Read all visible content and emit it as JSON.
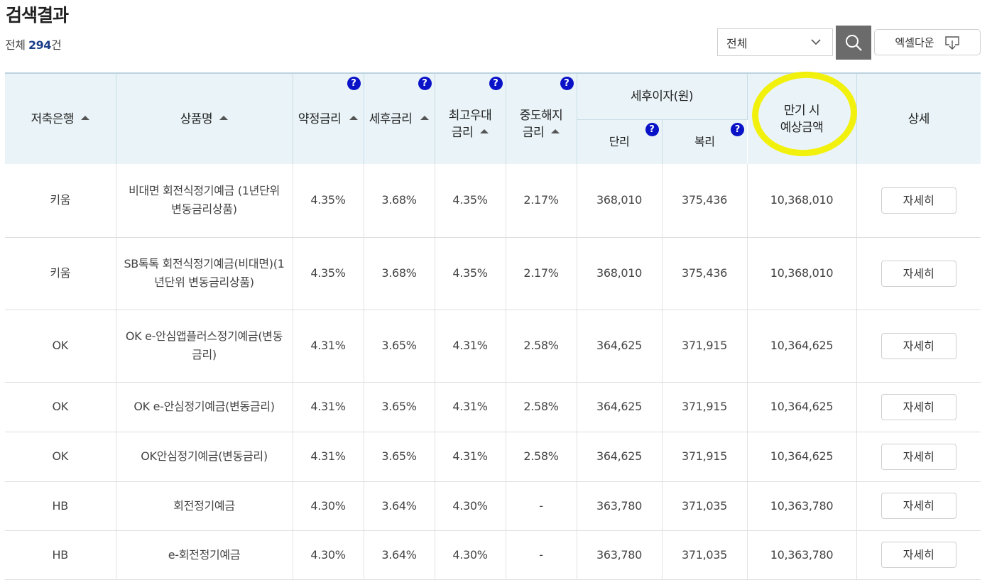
{
  "header": {
    "title": "검색결과",
    "count_prefix": "전체 ",
    "count_value": "294",
    "count_suffix": "건"
  },
  "toolbar": {
    "filter_value": "전체",
    "search_icon": "search-icon",
    "excel_label": "엑셀다운",
    "excel_icon": "download-icon"
  },
  "columns": {
    "bank": "저축은행",
    "product": "상품명",
    "contract_rate": "약정금리",
    "after_tax_rate": "세후금리",
    "max_pref_rate_line1": "최고우대",
    "max_pref_rate_line2": "금리",
    "early_term_rate_line1": "중도해지",
    "early_term_rate_line2": "금리",
    "after_tax_interest": "세후이자(원)",
    "simple": "단리",
    "compound": "복리",
    "maturity_line1": "만기 시",
    "maturity_line2": "예상금액",
    "detail": "상세",
    "help_glyph": "?"
  },
  "rows": [
    {
      "bank": "키움",
      "product": "비대면 회전식정기예금 (1년단위 변동금리상품)",
      "contract": "4.35%",
      "after_tax": "3.68%",
      "max_pref": "4.35%",
      "early": "2.17%",
      "simple": "368,010",
      "compound": "375,436",
      "maturity": "10,368,010",
      "detail": "자세히"
    },
    {
      "bank": "키움",
      "product": "SB톡톡 회전식정기예금(비대면)(1년단위 변동금리상품)",
      "contract": "4.35%",
      "after_tax": "3.68%",
      "max_pref": "4.35%",
      "early": "2.17%",
      "simple": "368,010",
      "compound": "375,436",
      "maturity": "10,368,010",
      "detail": "자세히"
    },
    {
      "bank": "OK",
      "product": "OK e-안심앱플러스정기예금(변동금리)",
      "contract": "4.31%",
      "after_tax": "3.65%",
      "max_pref": "4.31%",
      "early": "2.58%",
      "simple": "364,625",
      "compound": "371,915",
      "maturity": "10,364,625",
      "detail": "자세히"
    },
    {
      "bank": "OK",
      "product": "OK e-안심정기예금(변동금리)",
      "contract": "4.31%",
      "after_tax": "3.65%",
      "max_pref": "4.31%",
      "early": "2.58%",
      "simple": "364,625",
      "compound": "371,915",
      "maturity": "10,364,625",
      "detail": "자세히"
    },
    {
      "bank": "OK",
      "product": "OK안심정기예금(변동금리)",
      "contract": "4.31%",
      "after_tax": "3.65%",
      "max_pref": "4.31%",
      "early": "2.58%",
      "simple": "364,625",
      "compound": "371,915",
      "maturity": "10,364,625",
      "detail": "자세히"
    },
    {
      "bank": "HB",
      "product": "회전정기예금",
      "contract": "4.30%",
      "after_tax": "3.64%",
      "max_pref": "4.30%",
      "early": "-",
      "simple": "363,780",
      "compound": "371,035",
      "maturity": "10,363,780",
      "detail": "자세히"
    },
    {
      "bank": "HB",
      "product": "e-회전정기예금",
      "contract": "4.30%",
      "after_tax": "3.64%",
      "max_pref": "4.30%",
      "early": "-",
      "simple": "363,780",
      "compound": "371,035",
      "maturity": "10,363,780",
      "detail": "자세히"
    }
  ],
  "annotation": {
    "highlight_color": "#f2f000",
    "highlighted_column": "maturity"
  }
}
